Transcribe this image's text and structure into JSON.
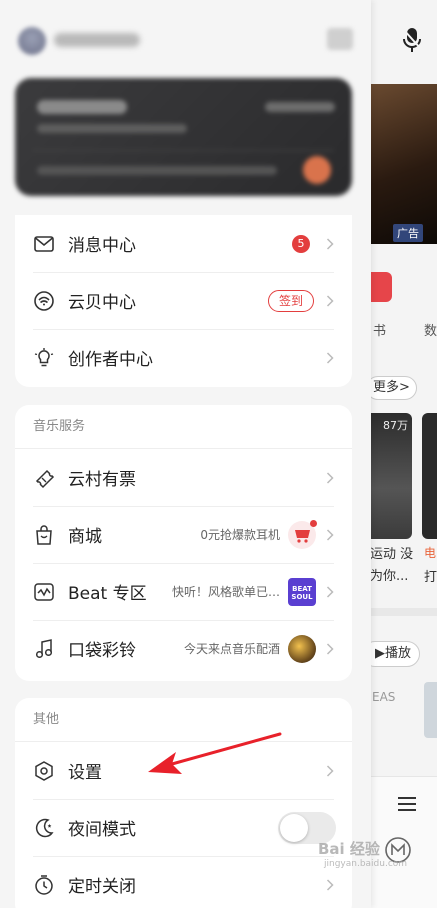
{
  "background": {
    "banner_ad": "广告",
    "entry_label_1": "每日推荐书",
    "entry_label_2": "数",
    "more_label": "更多",
    "play_count": "87万",
    "card_title_1": "运动 没为你...",
    "card_title_2_tag": "电",
    "card_title_2": "打",
    "play_label": "播放",
    "eas_text": "EAS"
  },
  "menu1": {
    "items": [
      {
        "label": "消息中心",
        "badge": "5"
      },
      {
        "label": "云贝中心",
        "pill": "签到"
      },
      {
        "label": "创作者中心"
      }
    ]
  },
  "music_service": {
    "title": "音乐服务",
    "items": [
      {
        "label": "云村有票"
      },
      {
        "label": "商城",
        "extra": "0元抢爆款耳机"
      },
      {
        "label": "Beat 专区",
        "extra": "快听！风格歌单已…",
        "thumb_text": "BEAT SOUL"
      },
      {
        "label": "口袋彩铃",
        "extra": "今天来点音乐配酒"
      }
    ]
  },
  "other": {
    "title": "其他",
    "items": [
      {
        "label": "设置"
      },
      {
        "label": "夜间模式",
        "toggle_on": false
      },
      {
        "label": "定时关闭"
      }
    ]
  },
  "watermark": {
    "text": "Bai 经验",
    "sub": "jingyan.baidu.com"
  },
  "colors": {
    "accent": "#e33e3e",
    "beat_purple": "#5a3fd1",
    "annotation_arrow": "#e8212a"
  }
}
